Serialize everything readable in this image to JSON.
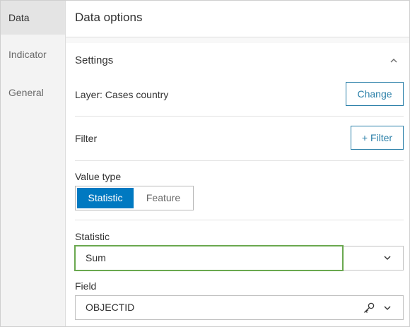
{
  "rail": {
    "tabs": [
      {
        "label": "Data",
        "active": true
      },
      {
        "label": "Indicator",
        "active": false
      },
      {
        "label": "General",
        "active": false
      }
    ]
  },
  "panel": {
    "title": "Data options"
  },
  "settings": {
    "title": "Settings",
    "collapse_icon": "chevron-up-icon",
    "layer_label": "Layer: Cases country",
    "change_button": "Change",
    "filter_label": "Filter",
    "filter_button": "+ Filter",
    "value_type_label": "Value type",
    "value_type_options": [
      "Statistic",
      "Feature"
    ],
    "value_type_selected": "Statistic",
    "statistic_label": "Statistic",
    "statistic_value": "Sum",
    "field_label": "Field",
    "field_value": "OBJECTID",
    "field_icon": "key-icon"
  },
  "colors": {
    "accent": "#0079c1",
    "button_outline": "#2a7fa8",
    "highlight": "#6aa84f"
  }
}
